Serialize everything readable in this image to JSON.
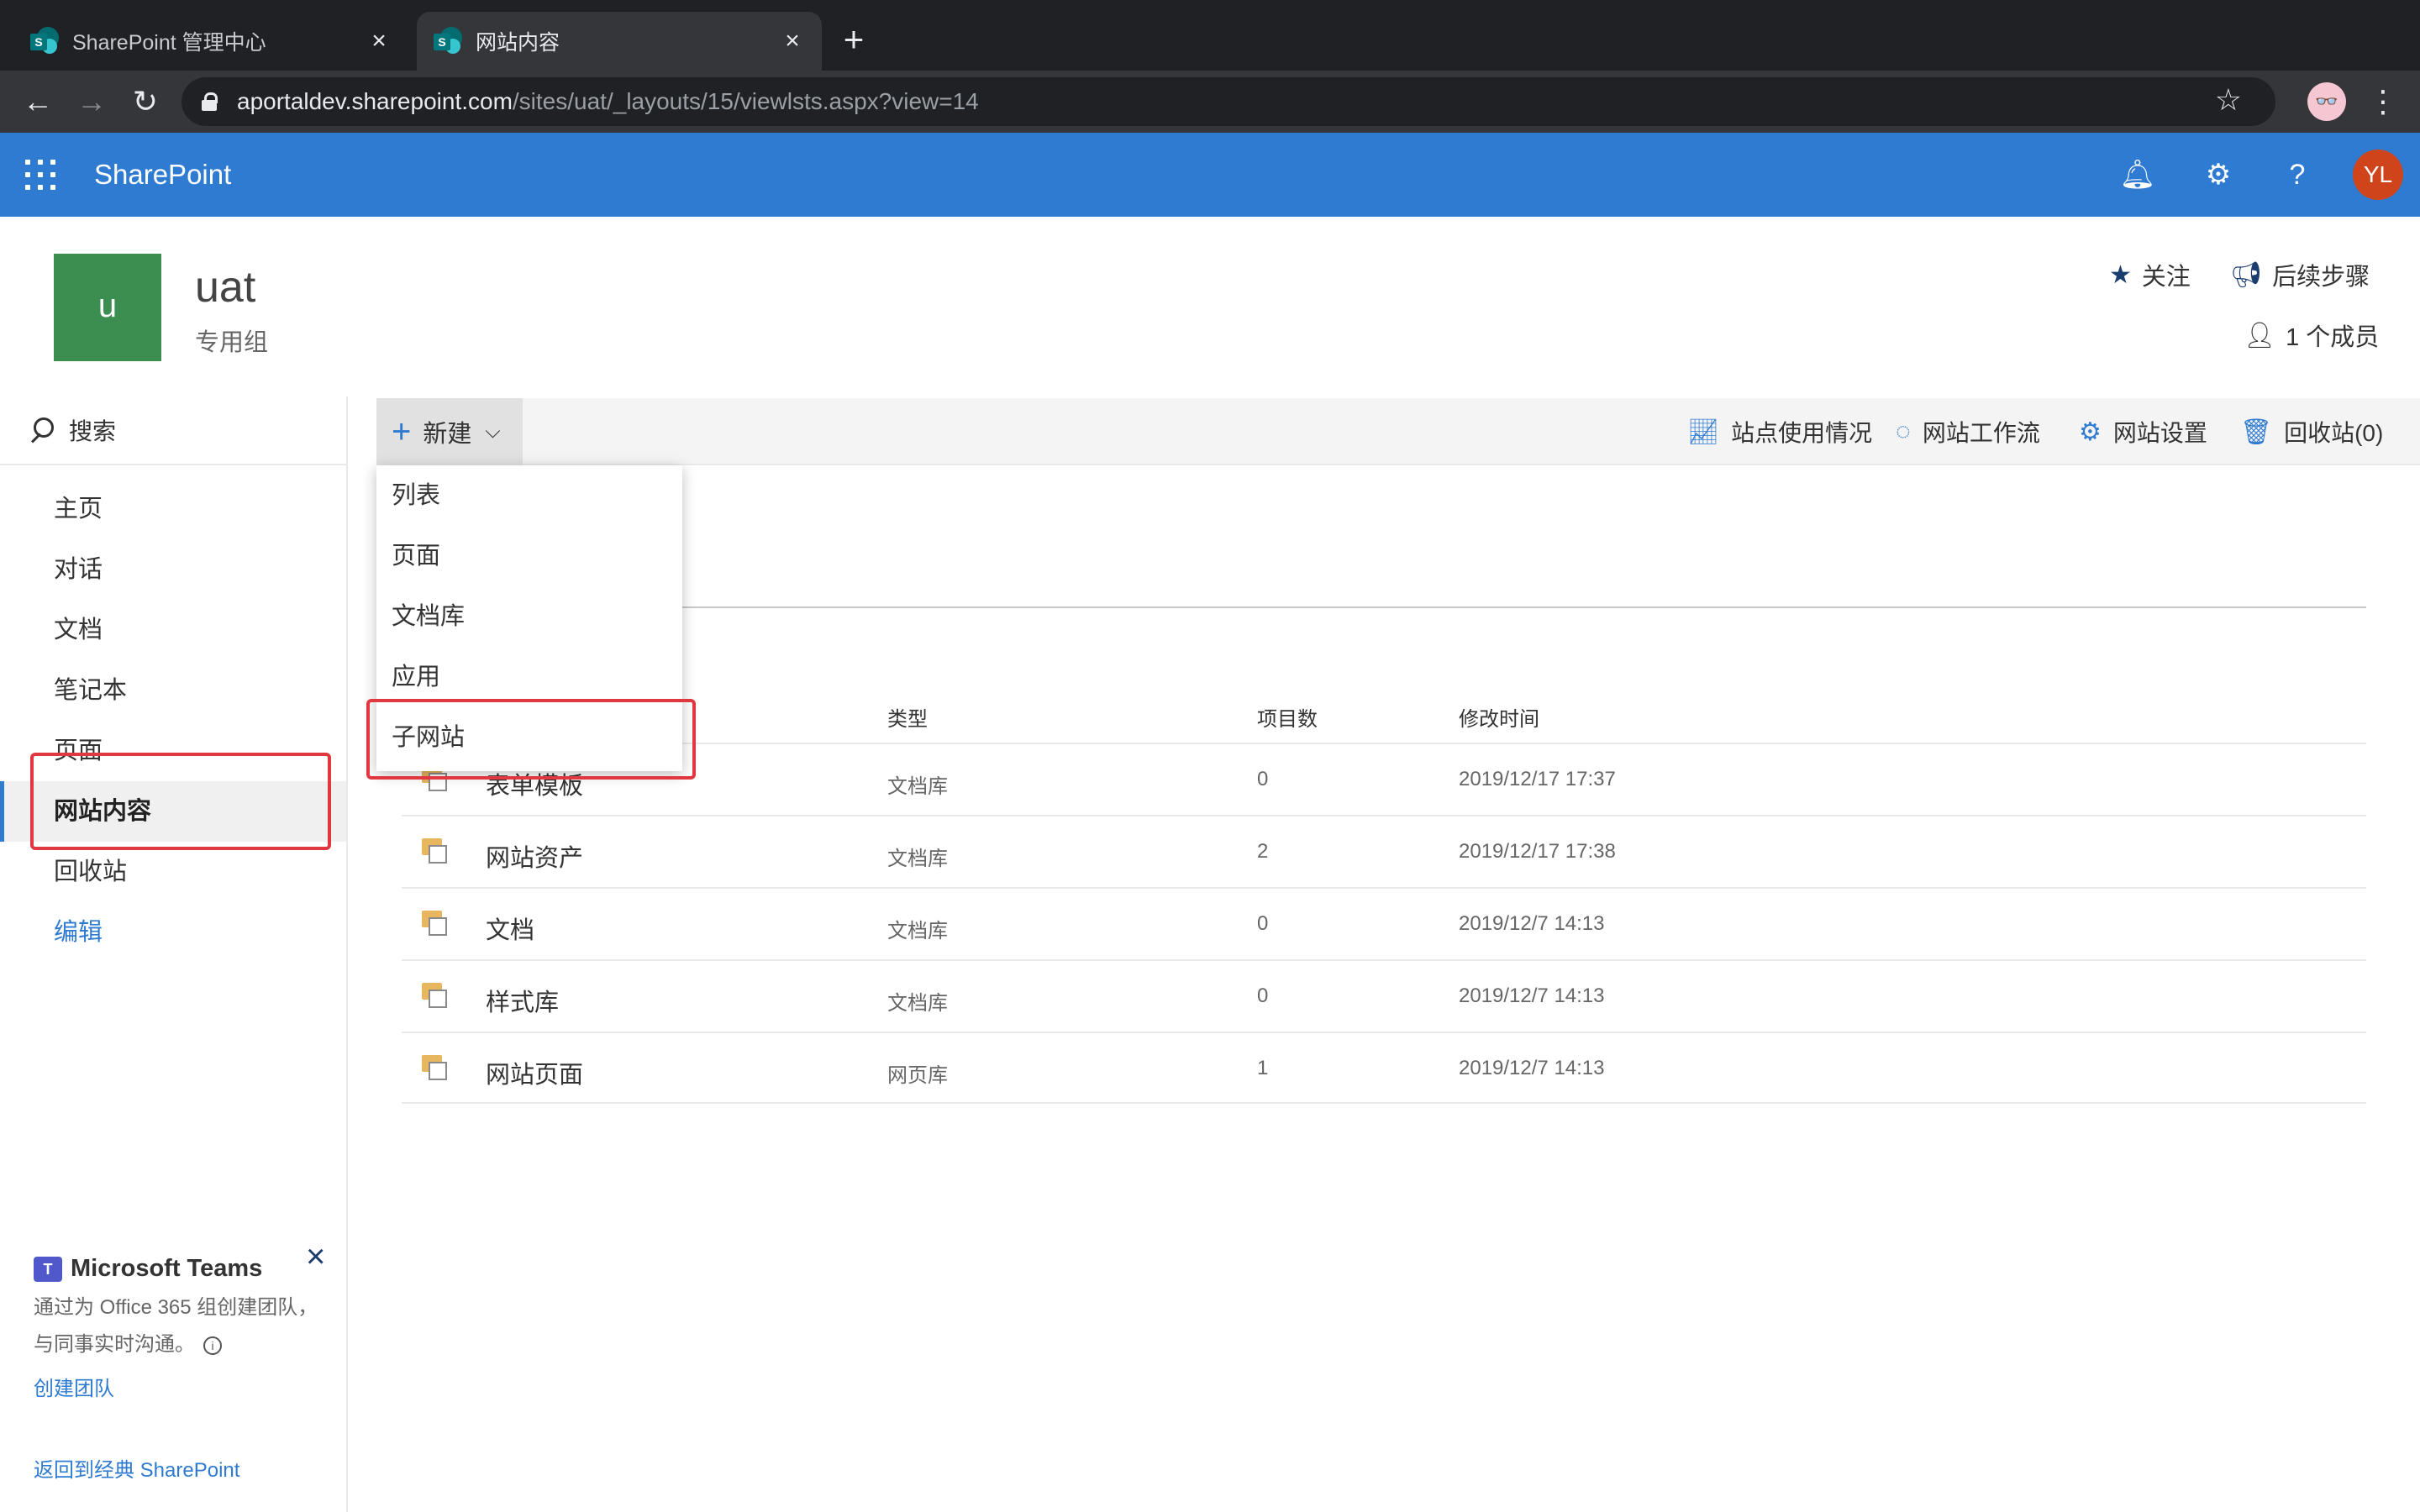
{
  "browser": {
    "tabs": [
      {
        "title": "SharePoint 管理中心",
        "active": false
      },
      {
        "title": "网站内容",
        "active": true
      }
    ],
    "url_host": "aportaldev.sharepoint.com",
    "url_path": "/sites/uat/_layouts/15/viewlsts.aspx?view=14"
  },
  "suitebar": {
    "brand": "SharePoint",
    "user_initials": "YL",
    "color": "#2f7bd1"
  },
  "site": {
    "logo_letter": "u",
    "title": "uat",
    "subtitle": "专用组",
    "follow_label": "关注",
    "next_steps_label": "后续步骤",
    "members_label": "1 个成员"
  },
  "leftnav": {
    "search_label": "搜索",
    "items": [
      {
        "label": "主页"
      },
      {
        "label": "对话"
      },
      {
        "label": "文档"
      },
      {
        "label": "笔记本"
      },
      {
        "label": "页面"
      },
      {
        "label": "网站内容",
        "selected": true
      },
      {
        "label": "回收站"
      },
      {
        "label": "编辑",
        "link": true
      }
    ],
    "teams": {
      "title": "Microsoft Teams",
      "description": "通过为 Office 365 组创建团队，与同事实时沟通。",
      "create_label": "创建团队"
    },
    "classic_link": "返回到经典 SharePoint"
  },
  "commandbar": {
    "new_label": "新建",
    "site_usage": "站点使用情况",
    "site_workflows": "网站工作流",
    "site_settings": "网站设置",
    "recycle_bin": "回收站(0)"
  },
  "new_menu": {
    "items": [
      "列表",
      "页面",
      "文档库",
      "应用",
      "子网站"
    ]
  },
  "table": {
    "headers": {
      "type": "类型",
      "count": "项目数",
      "modified": "修改时间"
    },
    "rows": [
      {
        "name": "表单模板",
        "type": "文档库",
        "count": "0",
        "modified": "2019/12/17 17:37"
      },
      {
        "name": "网站资产",
        "type": "文档库",
        "count": "2",
        "modified": "2019/12/17 17:38"
      },
      {
        "name": "文档",
        "type": "文档库",
        "count": "0",
        "modified": "2019/12/7 14:13"
      },
      {
        "name": "样式库",
        "type": "文档库",
        "count": "0",
        "modified": "2019/12/7 14:13"
      },
      {
        "name": "网站页面",
        "type": "网页库",
        "count": "1",
        "modified": "2019/12/7 14:13"
      }
    ]
  },
  "highlight_color": "#e0383e"
}
